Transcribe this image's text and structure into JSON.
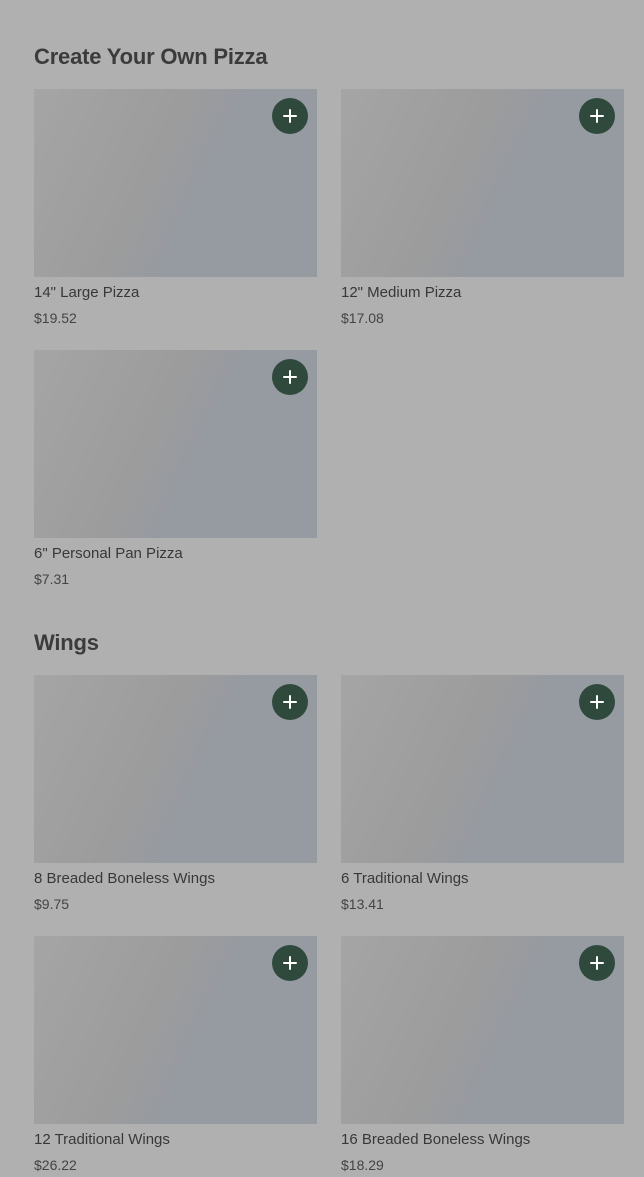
{
  "sections": [
    {
      "title": "Create Your Own Pizza",
      "items": [
        {
          "name": "14\" Large Pizza",
          "price": "$19.52",
          "add_icon": "plus-icon"
        },
        {
          "name": "12\" Medium Pizza",
          "price": "$17.08",
          "add_icon": "plus-icon"
        },
        {
          "name": "6\" Personal Pan Pizza",
          "price": "$7.31",
          "add_icon": "plus-icon"
        }
      ]
    },
    {
      "title": "Wings",
      "items": [
        {
          "name": "8 Breaded Boneless Wings",
          "price": "$9.75",
          "add_icon": "plus-icon"
        },
        {
          "name": "6 Traditional Wings",
          "price": "$13.41",
          "add_icon": "plus-icon"
        },
        {
          "name": "12 Traditional Wings",
          "price": "$26.22",
          "add_icon": "plus-icon"
        },
        {
          "name": "16 Breaded Boneless Wings",
          "price": "$18.29",
          "add_icon": "plus-icon"
        }
      ]
    }
  ],
  "colors": {
    "overlay_background": "#b0b0b0",
    "add_button": "#2f4a3d",
    "add_icon": "#ffffff"
  }
}
